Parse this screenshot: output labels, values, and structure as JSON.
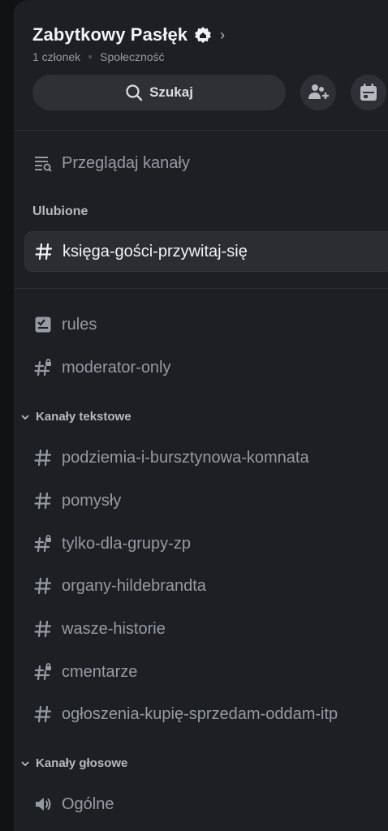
{
  "server": {
    "name": "Zabytkowy Pasłęk",
    "member_count": "1 członek",
    "community_label": "Społeczność"
  },
  "search": {
    "label": "Szukaj"
  },
  "browse_channels": "Przeglądaj kanały",
  "favorites": {
    "heading": "Ulubione",
    "channels": [
      {
        "name": "księga-gości-przywitaj-się",
        "icon": "hash-icon"
      }
    ]
  },
  "top_channels": [
    {
      "name": "rules",
      "icon": "rules-icon"
    },
    {
      "name": "moderator-only",
      "icon": "hash-lock-icon"
    }
  ],
  "text_category": {
    "heading": "Kanały tekstowe",
    "channels": [
      {
        "name": "podziemia-i-bursztynowa-komnata",
        "icon": "hash-icon"
      },
      {
        "name": "pomysły",
        "icon": "hash-icon"
      },
      {
        "name": "tylko-dla-grupy-zp",
        "icon": "hash-lock-icon"
      },
      {
        "name": "organy-hildebrandta",
        "icon": "hash-icon"
      },
      {
        "name": "wasze-historie",
        "icon": "hash-icon"
      },
      {
        "name": "cmentarze",
        "icon": "hash-lock-icon"
      },
      {
        "name": "ogłoszenia-kupię-sprzedam-oddam-itp",
        "icon": "hash-icon"
      }
    ]
  },
  "voice_category": {
    "heading": "Kanały głosowe",
    "channels": [
      {
        "name": "Ogólne",
        "icon": "speaker-icon"
      }
    ]
  },
  "colors": {
    "background": "#111214",
    "panel": "#1e1f22",
    "button": "#2e3035",
    "text_primary": "#f2f3f5",
    "text_muted": "#949ba4"
  }
}
